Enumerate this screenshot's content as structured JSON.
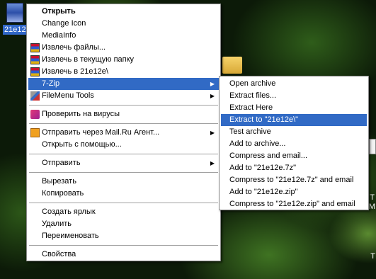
{
  "desktop": {
    "selected_icon_label": "21e12e",
    "edge_text_1": "Т",
    "edge_text_2": "M",
    "edge_text_3": "T"
  },
  "context_menu": {
    "items": [
      {
        "label": "Открыть",
        "bold": true
      },
      {
        "label": "Change Icon"
      },
      {
        "label": "MediaInfo"
      },
      {
        "label": "Извлечь файлы...",
        "icon": "winrar-icon"
      },
      {
        "label": "Извлечь в текущую папку",
        "icon": "winrar-icon"
      },
      {
        "label": "Извлечь в 21e12e\\",
        "icon": "winrar-icon"
      },
      {
        "label": "7-Zip",
        "submenu": true,
        "highlighted": true
      },
      {
        "label": "FileMenu Tools",
        "icon": "filemenu-tools-icon",
        "submenu": true
      },
      {
        "label": "Проверить на вирусы",
        "icon": "antivirus-icon"
      },
      {
        "label": "Отправить через Mail.Ru Агент...",
        "icon": "mailru-agent-icon",
        "submenu": true
      },
      {
        "label": "Открыть с помощью..."
      },
      {
        "label": "Отправить",
        "submenu": true
      },
      {
        "label": "Вырезать"
      },
      {
        "label": "Копировать"
      },
      {
        "label": "Создать ярлык"
      },
      {
        "label": "Удалить"
      },
      {
        "label": "Переименовать"
      },
      {
        "label": "Свойства"
      }
    ]
  },
  "submenu_7zip": {
    "items": [
      {
        "label": "Open archive"
      },
      {
        "label": "Extract files..."
      },
      {
        "label": "Extract Here"
      },
      {
        "label": "Extract to \"21e12e\\\"",
        "highlighted": true
      },
      {
        "label": "Test archive"
      },
      {
        "label": "Add to archive..."
      },
      {
        "label": "Compress and email..."
      },
      {
        "label": "Add to \"21e12e.7z\""
      },
      {
        "label": "Compress to \"21e12e.7z\" and email"
      },
      {
        "label": "Add to \"21e12e.zip\""
      },
      {
        "label": "Compress to \"21e12e.zip\" and email"
      }
    ]
  },
  "colors": {
    "highlight": "#316ac5",
    "menu_bg": "#ffffff"
  }
}
